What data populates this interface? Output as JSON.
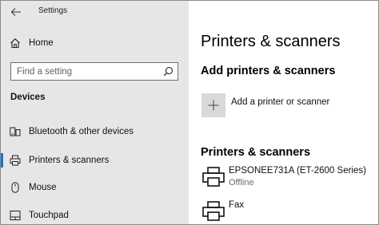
{
  "window": {
    "title": "Settings"
  },
  "sidebar": {
    "home_label": "Home",
    "search": {
      "placeholder": "Find a setting"
    },
    "section_label": "Devices",
    "items": [
      {
        "label": "Bluetooth & other devices",
        "icon": "bluetooth-devices-icon"
      },
      {
        "label": "Printers & scanners",
        "icon": "printer-icon",
        "selected": true
      },
      {
        "label": "Mouse",
        "icon": "mouse-icon"
      },
      {
        "label": "Touchpad",
        "icon": "touchpad-icon"
      }
    ]
  },
  "main": {
    "page_title": "Printers & scanners",
    "add_section": {
      "heading": "Add printers & scanners",
      "add_button_label": "Add a printer or scanner"
    },
    "list_section": {
      "heading": "Printers & scanners",
      "devices": [
        {
          "name": "EPSONEE731A (ET-2600 Series)",
          "status": "Offline",
          "icon": "printer-icon"
        },
        {
          "name": "Fax",
          "status": "",
          "icon": "printer-icon"
        }
      ]
    }
  },
  "colors": {
    "sidebar_background": "#e6e6e6",
    "accent": "#1a73c8",
    "status_text": "#6b6b6b"
  }
}
